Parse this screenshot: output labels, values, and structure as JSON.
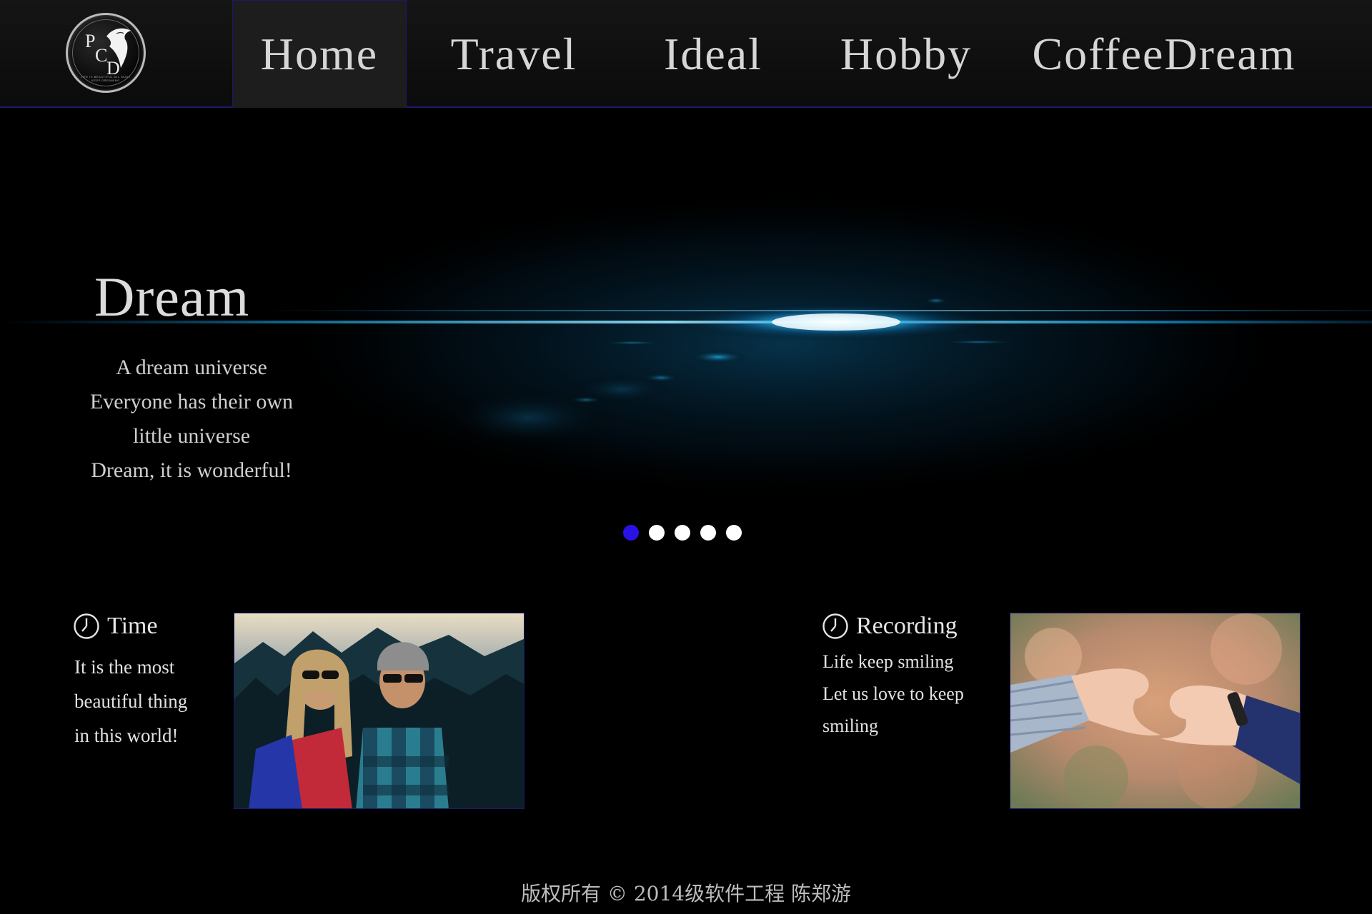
{
  "logo": {
    "letters": [
      "P",
      "C",
      "D"
    ],
    "ring_text": "LIFE IS BEAUTIFUL ALL MUST KEEP DREAMING"
  },
  "nav": {
    "items": [
      {
        "label": "Home",
        "active": true
      },
      {
        "label": "Travel",
        "active": false
      },
      {
        "label": "Ideal",
        "active": false
      },
      {
        "label": "Hobby",
        "active": false
      },
      {
        "label": "CoffeeDream",
        "active": false
      }
    ]
  },
  "hero": {
    "title": "Dream",
    "lines": [
      "A dream universe",
      "Everyone has their own",
      "little universe",
      "Dream, it is wonderful!"
    ],
    "slide_count": 5,
    "active_slide": 1
  },
  "features": {
    "time": {
      "title": "Time",
      "lines": [
        "It is the most",
        "beautiful thing",
        "in this world!"
      ],
      "icon": "clock-icon"
    },
    "recording": {
      "title": "Recording",
      "lines": [
        "Life keep smiling",
        "Let us love to keep",
        "smiling"
      ],
      "icon": "clock-icon"
    }
  },
  "footer": {
    "text": "版权所有 © 2014级软件工程 陈郑游"
  },
  "colors": {
    "accent": "#2a12e6",
    "nav_border": "#1c1870",
    "glow": "#15b4ff"
  }
}
